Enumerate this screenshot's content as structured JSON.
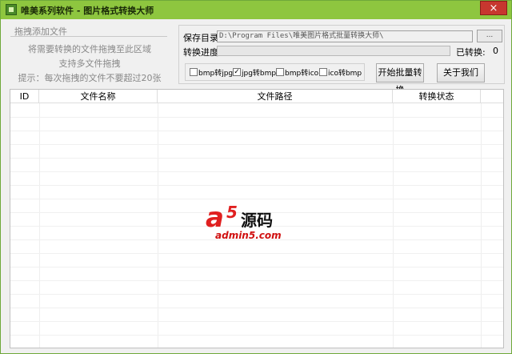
{
  "window": {
    "title": "唯美系列软件 - 图片格式转换大师",
    "close_glyph": "×"
  },
  "drop_panel": {
    "title": "拖拽添加文件",
    "lines": [
      "将需要转换的文件拖拽至此区域",
      "支持多文件拖拽",
      "提示：每次拖拽的文件不要超过20张"
    ]
  },
  "save": {
    "label": "保存目录:",
    "path_value": "D:\\Program Files\\唯美图片格式批量转换大师\\",
    "browse_label": "..."
  },
  "progress": {
    "label": "转换进度:",
    "value_percent": 0,
    "converted_label": "已转换:",
    "converted_count": "0"
  },
  "options": [
    {
      "label": "bmp转jpg",
      "checked": false,
      "checked_glyph": ""
    },
    {
      "label": "jpg转bmp",
      "checked": true,
      "checked_glyph": "✓"
    },
    {
      "label": "bmp转ico",
      "checked": false,
      "checked_glyph": ""
    },
    {
      "label": "ico转bmp",
      "checked": false,
      "checked_glyph": ""
    }
  ],
  "buttons": {
    "start": "开始批量转换",
    "about": "关于我们"
  },
  "table": {
    "columns": [
      "ID",
      "文件名称",
      "文件路径",
      "转换状态"
    ],
    "rows": []
  },
  "watermark": {
    "letter": "a",
    "digit": "5",
    "name": "源码",
    "url": "admin5.com"
  },
  "colors": {
    "titlebar": "#8ec63f",
    "close": "#c7372f",
    "progress_fill": "#3cb043"
  }
}
